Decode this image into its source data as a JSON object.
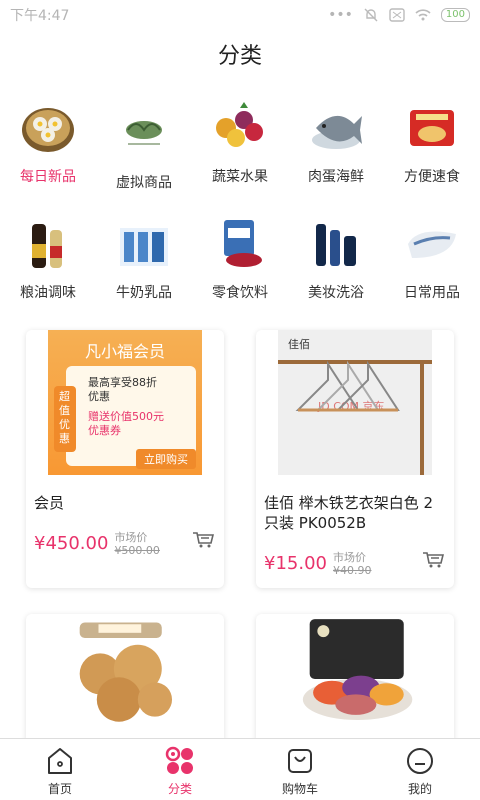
{
  "status": {
    "time": "下午4:47",
    "battery": "100"
  },
  "page_title": "分类",
  "categories": [
    {
      "label": "每日新品",
      "icon": "dumpling-image",
      "active": true
    },
    {
      "label": "虚拟商品",
      "icon": "leaf-logo-image"
    },
    {
      "label": "蔬菜水果",
      "icon": "fruit-basket-image"
    },
    {
      "label": "肉蛋海鲜",
      "icon": "fish-image"
    },
    {
      "label": "方便速食",
      "icon": "instant-noodle-image"
    },
    {
      "label": "粮油调味",
      "icon": "soy-sauce-image"
    },
    {
      "label": "牛奶乳品",
      "icon": "milk-box-image"
    },
    {
      "label": "零食饮料",
      "icon": "cranberry-snack-image"
    },
    {
      "label": "美妆洗浴",
      "icon": "cosmetics-image"
    },
    {
      "label": "日常用品",
      "icon": "pillow-image"
    }
  ],
  "products": [
    {
      "name": "会员",
      "price": "¥450.00",
      "market_label": "市场价",
      "market_price": "¥500.00",
      "banner": {
        "title": "凡小福会员",
        "side": "超值优惠",
        "line1": "最高享受88折",
        "line2": "优惠",
        "line3": "赠送价值500元",
        "line4": "优惠券",
        "btn": "立即购买"
      }
    },
    {
      "name": "佳佰 榉木铁艺衣架白色 2只装 PK0052B",
      "price": "¥15.00",
      "market_label": "市场价",
      "market_price": "¥40.90",
      "brand": "佳佰",
      "watermark": "JD.COM 京东"
    },
    {
      "name": "",
      "price": "",
      "image": "cookie-jar-image"
    },
    {
      "name": "",
      "price": "",
      "image": "veggie-chips-image"
    }
  ],
  "tabs": [
    {
      "label": "首页",
      "icon": "home-icon"
    },
    {
      "label": "分类",
      "icon": "category-icon",
      "active": true
    },
    {
      "label": "购物车",
      "icon": "shopping-bag-icon"
    },
    {
      "label": "我的",
      "icon": "profile-icon"
    }
  ],
  "colors": {
    "accent": "#e8336b",
    "banner_orange": "#f7a23a"
  }
}
